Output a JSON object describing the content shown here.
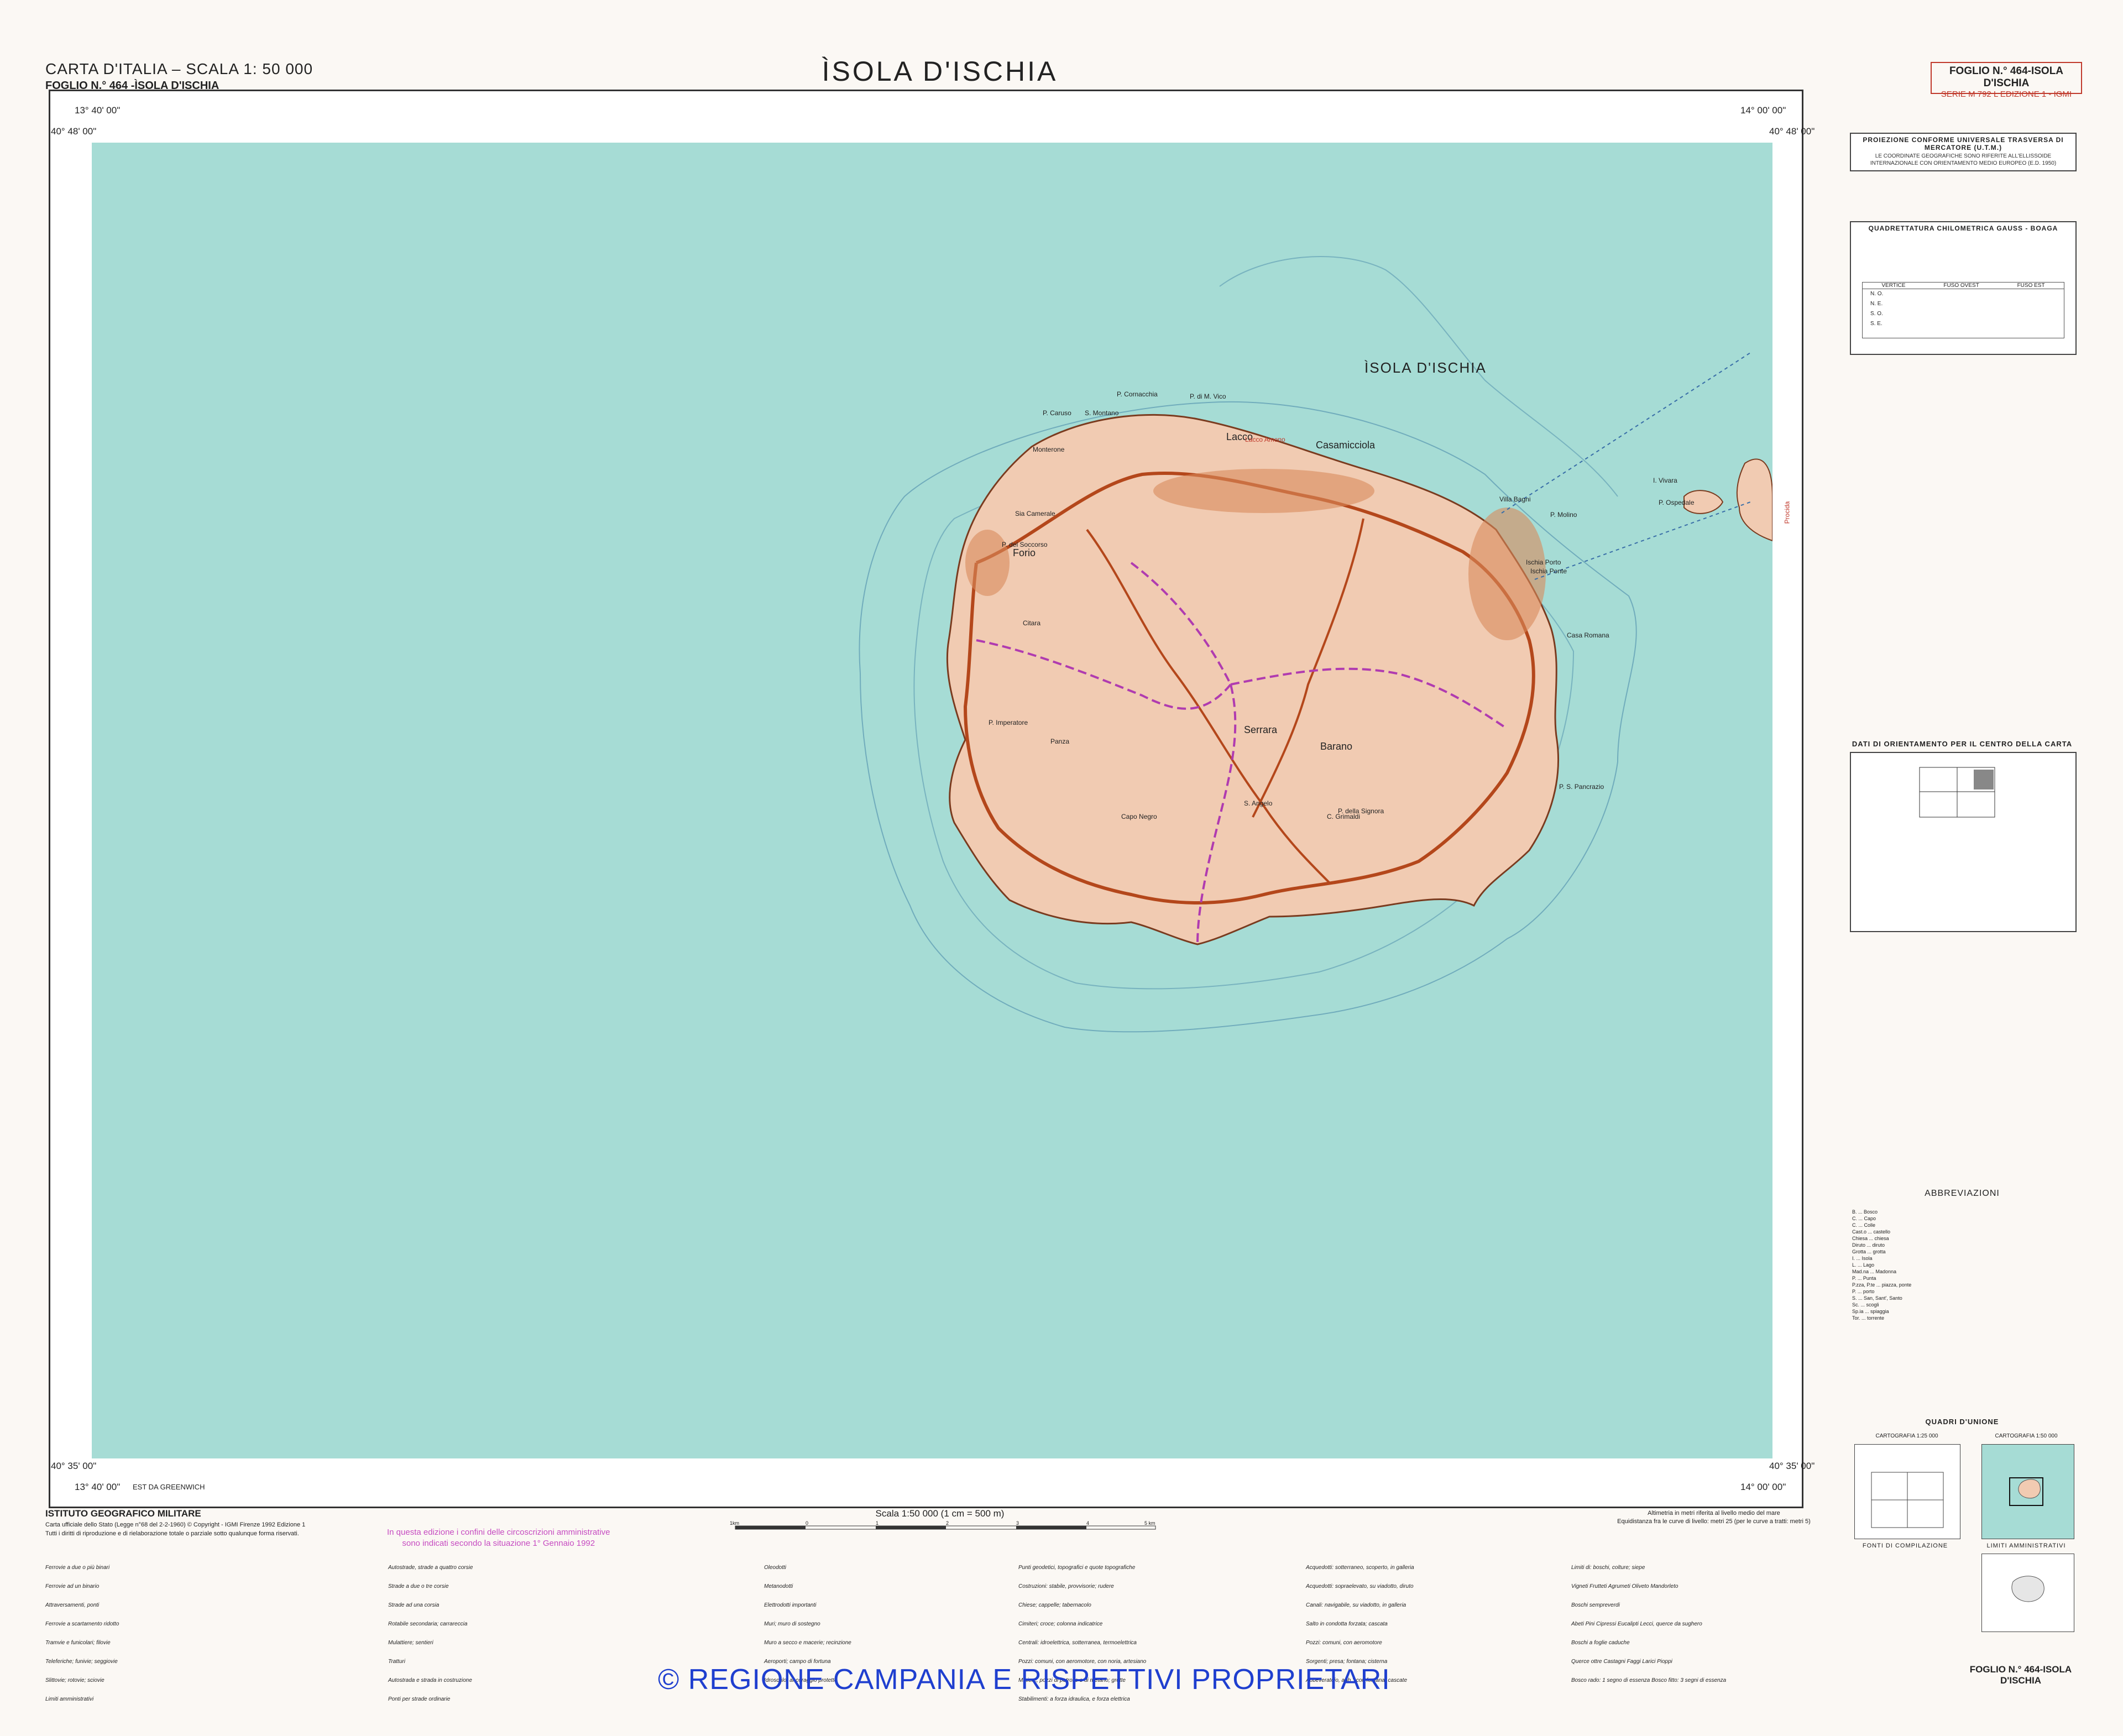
{
  "header": {
    "series_title": "CARTA D'ITALIA – SCALA 1: 50 000",
    "sheet_subtitle": "FOGLIO N.° 464 -ÌSOLA D'ISCHIA",
    "main_title": "ÌSOLA D'ISCHIA",
    "sheet_box_line1": "FOGLIO N.° 464-ISOLA D'ISCHIA",
    "sheet_box_line2": "SERIE M 792 L EDIZIONE 1 - IGMI"
  },
  "coordinates": {
    "top_left_lon": "13° 40' 00\"",
    "top_left_lat": "40° 48' 00\"",
    "top_right_lon": "14° 00' 00\"",
    "top_right_lat": "40° 48' 00\"",
    "bottom_left_lat": "40° 35' 00\"",
    "bottom_left_lon": "13° 40' 00\"",
    "bottom_left_note": "EST DA GREENWICH",
    "bottom_right_lat": "40° 35' 00\"",
    "bottom_right_lon": "14° 00' 00\""
  },
  "compass_scale_ticks": [
    "4°",
    "3°",
    "2°",
    "1°",
    "0°",
    "1°",
    "2°",
    "3°",
    "4°"
  ],
  "map": {
    "island_title": "ÌSOLA D'ISCHIA",
    "procida_label": "Procida",
    "towns": [
      "Forio",
      "Lacco",
      "Casamicciola",
      "Serrara",
      "Barano",
      "S. Angelo",
      "Ischia Porto",
      "I. Vivara"
    ],
    "places": [
      "P. Cornacchia",
      "P. di M. Vico",
      "S. Montano",
      "P. Caruso",
      "Monterone",
      "Sia Camerale",
      "P. del Soccorso",
      "Citara",
      "P. Imperatore",
      "Panza",
      "Capo Negro",
      "Casa Romana",
      "Ischia Ponte",
      "C. Grimaldi",
      "P. S. Pancrazio",
      "P. della Signora",
      "Lacco Ameno",
      "Villa Bagni",
      "P. Molino",
      "P. Ospedale"
    ],
    "sea_color": "#a6dcd5",
    "land_color": "#f1cbb2"
  },
  "side_panels": {
    "projection_title": "PROIEZIONE CONFORME UNIVERSALE TRASVERSA DI MERCATORE (U.T.M.)",
    "projection_note": "LE COORDINATE GEOGRAFICHE SONO RIFERITE ALL'ELLISSOIDE INTERNAZIONALE CON ORIENTAMENTO MEDIO EUROPEO (E.D. 1950)",
    "grid_title": "QUADRETTATURA CHILOMETRICA GAUSS - BOAGA",
    "grid_table_headers": [
      "VERTICE",
      "FUSO OVEST",
      "FUSO EST"
    ],
    "grid_table_rows": [
      "N. O.",
      "N. E.",
      "S. O.",
      "S. E."
    ],
    "orient_title": "DATI DI ORIENTAMENTO PER IL CENTRO DELLA CARTA",
    "abbrev_title": "ABBREVIAZIONI",
    "abbreviations": [
      "B. ... Bosco",
      "C. ... Capo",
      "C. ... Colle",
      "Cast.o ... castello",
      "Chiesa ... chiesa",
      "Diruto ... diruto",
      "Grotta ... grotta",
      "I. ... Isola",
      "L. ... Lago",
      "Mad.na ... Madonna",
      "P. ... Punta",
      "P.zza, P.te ... piazza, ponte",
      "P. ... porto",
      "S. ... San, Sant', Santo",
      "Sc. ... scogli",
      "Sp.ia ... spiaggia",
      "Tor. ... torrente"
    ],
    "union_title": "QUADRI D'UNIONE",
    "union_left_caption": "CARTOGRAFIA 1:25 000",
    "union_right_caption": "CARTOGRAFIA 1:50 000",
    "sources_title": "FONTI DI COMPILAZIONE",
    "admin_title": "LIMITI AMMINISTRATIVI",
    "bottom_sheet_label": "FOGLIO N.° 464-ISOLA D'ISCHIA"
  },
  "footer": {
    "institute": "ISTITUTO GEOGRAFICO MILITARE",
    "institute_note": "Carta ufficiale dello Stato (Legge n°68 del 2-2-1960) © Copyright - IGMI Firenze 1992 Edizione 1",
    "rights_note": "Tutti i diritti di riproduzione e di rielaborazione totale o parziale sotto qualunque forma riservati.",
    "admin_note_line1": "In questa edizione i confini delle circoscrizioni amministrative",
    "admin_note_line2": "sono indicati secondo la situazione 1° Gennaio 1992",
    "scale_title": "Scala 1:50 000 (1 cm = 500 m)",
    "scale_ticks": [
      "1km",
      "0",
      "1",
      "2",
      "3",
      "4",
      "5 km"
    ],
    "altimetry_note1": "Altimetria in metri riferita al livello medio del mare",
    "altimetry_note2": "Equidistanza fra le curve di livello: metri 25 (per le curve a tratti: metri 5)",
    "copyright": "© REGIONE CAMPANIA E RISPETTIVI PROPRIETARI"
  },
  "legend_columns": [
    [
      "Ferrovie a due o più binari",
      "Ferrovie ad un binario",
      "Attraversamenti, ponti",
      "Ferrovie a scartamento ridotto",
      "Tramvie e funicolari; filovie",
      "Teleferiche; funivie; seggiovie",
      "Slittovie; rotovie; sciovie",
      "Limiti amministrativi"
    ],
    [
      "Autostrade, strade a quattro corsie",
      "Strade a due o tre corsie",
      "Strade ad una corsia",
      "Rotabile secondaria; carrareccia",
      "Mulattiere; sentieri",
      "Tratturi",
      "Autostrada e strada in costruzione",
      "Ponti per strade ordinarie"
    ],
    [
      "Oleodotti",
      "Metanodotti",
      "Elettrodotti importanti",
      "Muri; muro di sostegno",
      "Muro a secco e macerie; recinzione",
      "Aeroporti; campo di fortuna",
      "Idroscalo; ancoraggio protetto"
    ],
    [
      "Punti geodetici, topografici e quote topografiche",
      "Costruzioni: stabile, provvisorie; rudere",
      "Chiese; cappelle; tabernacolo",
      "Cimiteri; croce; colonna indicatrice",
      "Centrali: idroelettrica, sotterranea, termoelettrica",
      "Pozzi: comuni, con aeromotore, con noria, artesiano",
      "Miniere, pozzi di petrolio e di metano; grotte",
      "Stabilimenti: a forza idraulica, e forza elettrica"
    ],
    [
      "Acquedotti: sotterraneo, scoperto, in galleria",
      "Acquedotti: sopraelevato, su viadotto, diruto",
      "Canali: navigabile, su viadotto, in galleria",
      "Salto in condotta forzata; cascata",
      "Pozzi: comuni, con aeromotore",
      "Sorgenti; presa; fontana; cisterna",
      "Abbeveratoio, abb.° con fontana; cascate"
    ],
    [
      "Limiti di: boschi, colture; siepe",
      "Vigneti  Frutteti  Agrumeti  Oliveto  Mandorleto",
      "Boschi sempreverdi",
      "Abeti  Pini  Cipressi  Eucalipti  Lecci, querce da sughero",
      "Boschi a foglie caduche",
      "Querce ottre  Castagni  Faggi  Larici  Pioppi",
      "Bosco rado: 1 segno di essenza   Bosco fitto: 3 segni di essenza"
    ]
  ]
}
